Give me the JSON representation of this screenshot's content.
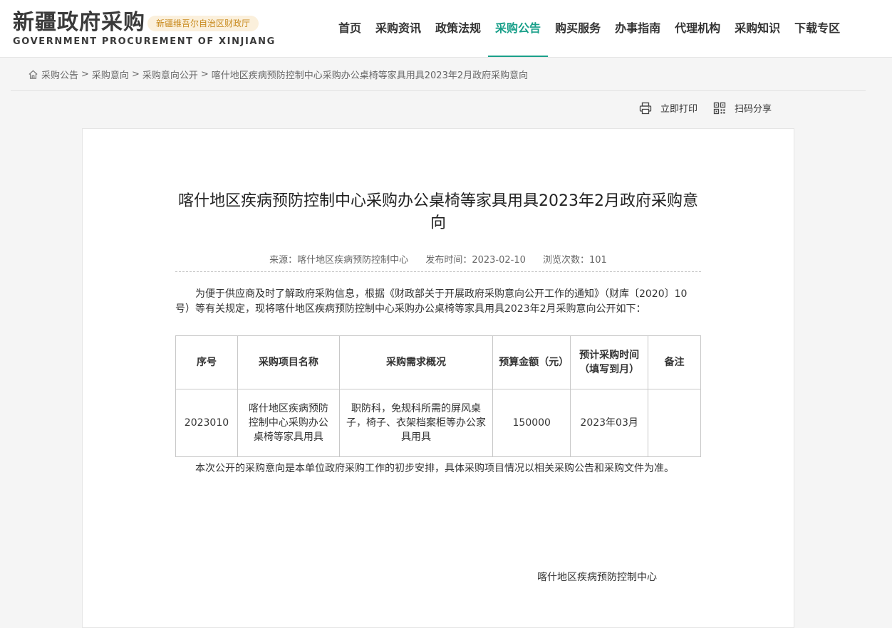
{
  "header": {
    "logo_cn": "新疆政府采购",
    "logo_badge": "新疆维吾尔自治区财政厅",
    "logo_en": "GOVERNMENT PROCUREMENT OF XINJIANG",
    "accent_color": "#1aa08a",
    "nav": [
      "首页",
      "采购资讯",
      "政策法规",
      "采购公告",
      "购买服务",
      "办事指南",
      "代理机构",
      "采购知识",
      "下载专区"
    ],
    "nav_active": "采购公告"
  },
  "breadcrumb": {
    "icon": "home-icon",
    "items": [
      "采购公告",
      "采购意向",
      "采购意向公开",
      "喀什地区疾病预防控制中心采购办公桌椅等家具用具2023年2月政府采购意向"
    ],
    "separator": ">"
  },
  "tools": {
    "print": {
      "icon": "printer-icon",
      "label": "立即打印"
    },
    "share": {
      "icon": "qrcode-icon",
      "label": "扫码分享"
    }
  },
  "article": {
    "title": "喀什地区疾病预防控制中心采购办公桌椅等家具用具2023年2月政府采购意向",
    "source": "来源：喀什地区疾病预防控制中心",
    "publish_time": "发布时间：2023-02-10",
    "views": "浏览次数：101",
    "intro": "为便于供应商及时了解政府采购信息，根据《财政部关于开展政府采购意向公开工作的通知》（财库〔2020〕10号）等有关规定，现将喀什地区疾病预防控制中心采购办公桌椅等家具用具2023年2月采购意向公开如下：",
    "table": {
      "headers": [
        "序号",
        "采购项目名称",
        "采购需求概况",
        "预算金额（元）",
        "预计采购时间（填写到月）",
        "备注"
      ],
      "rows": [
        [
          "2023010",
          "喀什地区疾病预防控制中心采购办公桌椅等家具用具",
          "职防科，免规科所需的屏风桌子，椅子、衣架档案柜等办公家具用具",
          "150000",
          "2023年03月",
          ""
        ]
      ]
    },
    "closing": "本次公开的采购意向是本单位政府采购工作的初步安排，具体采购项目情况以相关采购公告和采购文件为准。",
    "signature": "喀什地区疾病预防控制中心"
  }
}
